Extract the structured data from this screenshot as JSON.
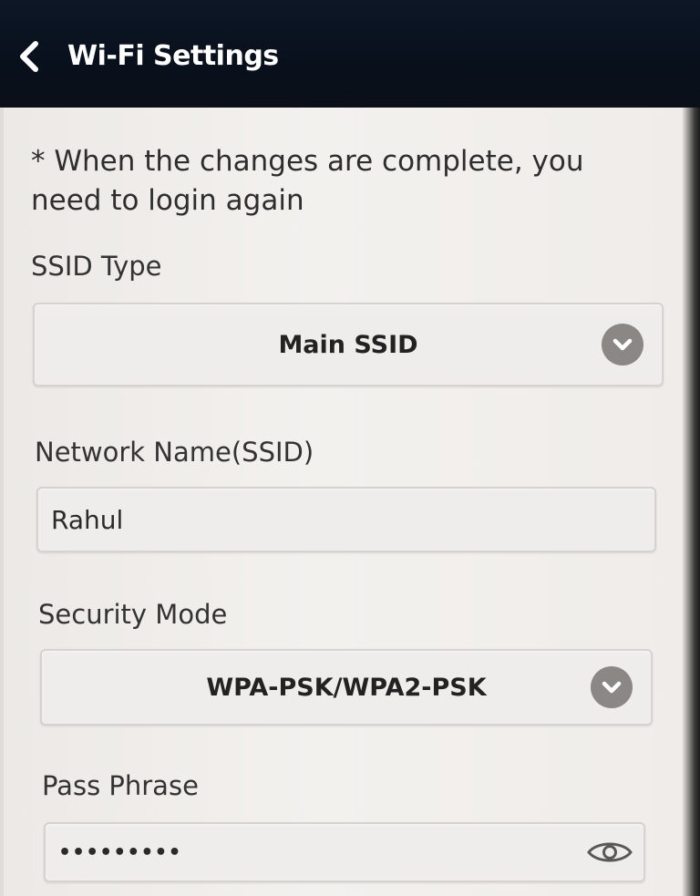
{
  "header": {
    "title": "Wi-Fi Settings",
    "back_icon": "chevron-left-icon"
  },
  "notice": "* When the changes are complete, you need to login again",
  "ssid_type": {
    "label": "SSID Type",
    "value": "Main SSID",
    "icon": "chevron-down-icon"
  },
  "network_name": {
    "label": "Network Name(SSID)",
    "value": "Rahul"
  },
  "security_mode": {
    "label": "Security Mode",
    "value": "WPA-PSK/WPA2-PSK",
    "icon": "chevron-down-icon"
  },
  "pass_phrase": {
    "label": "Pass Phrase",
    "value": "•••••••••",
    "icon": "eye-icon"
  },
  "colors": {
    "header_bg": "#08101c",
    "content_bg": "#f1efec",
    "chevron_bg": "#8a8784"
  }
}
